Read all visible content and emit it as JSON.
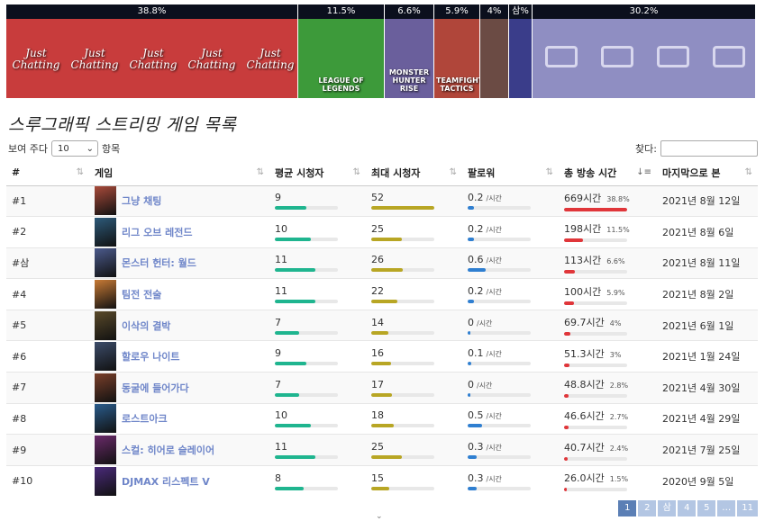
{
  "strip": [
    {
      "label": "38.8%",
      "caption": "Just Chatting",
      "color": "#c83c3c"
    },
    {
      "label": "11.5%",
      "caption": "LEAGUE OF LEGENDS",
      "color": "#3d9a3a"
    },
    {
      "label": "6.6%",
      "caption": "MONSTER HUNTER RISE",
      "color": "#6a5f9c"
    },
    {
      "label": "5.9%",
      "caption": "TEAMFIGHT TACTICS",
      "color": "#b0463a"
    },
    {
      "label": "4%",
      "caption": "",
      "color": "#6b4b44"
    },
    {
      "label": "삼%",
      "caption": "",
      "color": "#3a3d8a"
    },
    {
      "label": "30.2%",
      "caption": "",
      "color": "#8f8ec2"
    }
  ],
  "title": "스루그래픽 스트리밍 게임 목록",
  "length": {
    "prefix": "보여 주다",
    "value": "10",
    "suffix": "항목"
  },
  "search": {
    "label": "찾다:",
    "value": ""
  },
  "columns": [
    "#",
    "게임",
    "평균 시청자",
    "최대 시청자",
    "팔로워",
    "총 방송 시간",
    "마지막으로 본"
  ],
  "rows": [
    {
      "rank": "#1",
      "game": "그냥 채팅",
      "avg": "9",
      "avg_pct": 0.5,
      "max": "52",
      "max_pct": 1.0,
      "follow": "0.2",
      "follow_unit": "/시간",
      "follow_pct": 0.1,
      "hours": "669시간",
      "hours_pct_text": "38.8%",
      "hours_pct": 1.0,
      "last": "2021년 8월 12일",
      "thumb": "#a84a3a"
    },
    {
      "rank": "#2",
      "game": "리그 오브 레전드",
      "avg": "10",
      "avg_pct": 0.57,
      "max": "25",
      "max_pct": 0.48,
      "follow": "0.2",
      "follow_unit": "/시간",
      "follow_pct": 0.1,
      "hours": "198시간",
      "hours_pct_text": "11.5%",
      "hours_pct": 0.3,
      "last": "2021년 8월 6일",
      "thumb": "#2d5a7a"
    },
    {
      "rank": "#삼",
      "game": "몬스터 헌터: 월드",
      "avg": "11",
      "avg_pct": 0.64,
      "max": "26",
      "max_pct": 0.5,
      "follow": "0.6",
      "follow_unit": "/시간",
      "follow_pct": 0.28,
      "hours": "113시간",
      "hours_pct_text": "6.6%",
      "hours_pct": 0.17,
      "last": "2021년 8월 11일",
      "thumb": "#4b5a8c"
    },
    {
      "rank": "#4",
      "game": "팀전 전술",
      "avg": "11",
      "avg_pct": 0.64,
      "max": "22",
      "max_pct": 0.42,
      "follow": "0.2",
      "follow_unit": "/시간",
      "follow_pct": 0.1,
      "hours": "100시간",
      "hours_pct_text": "5.9%",
      "hours_pct": 0.15,
      "last": "2021년 8월 2일",
      "thumb": "#c77a35"
    },
    {
      "rank": "#5",
      "game": "이삭의 결박",
      "avg": "7",
      "avg_pct": 0.38,
      "max": "14",
      "max_pct": 0.27,
      "follow": "0",
      "follow_unit": "/시간",
      "follow_pct": 0,
      "hours": "69.7시간",
      "hours_pct_text": "4%",
      "hours_pct": 0.1,
      "last": "2021년 6월 1일",
      "thumb": "#5a4a2a"
    },
    {
      "rank": "#6",
      "game": "할로우 나이트",
      "avg": "9",
      "avg_pct": 0.5,
      "max": "16",
      "max_pct": 0.31,
      "follow": "0.1",
      "follow_unit": "/시간",
      "follow_pct": 0.05,
      "hours": "51.3시간",
      "hours_pct_text": "3%",
      "hours_pct": 0.08,
      "last": "2021년 1월 24일",
      "thumb": "#3c4c6a"
    },
    {
      "rank": "#7",
      "game": "동굴에 들어가다",
      "avg": "7",
      "avg_pct": 0.38,
      "max": "17",
      "max_pct": 0.33,
      "follow": "0",
      "follow_unit": "/시간",
      "follow_pct": 0,
      "hours": "48.8시간",
      "hours_pct_text": "2.8%",
      "hours_pct": 0.07,
      "last": "2021년 4월 30일",
      "thumb": "#7a3f2a"
    },
    {
      "rank": "#8",
      "game": "로스트아크",
      "avg": "10",
      "avg_pct": 0.57,
      "max": "18",
      "max_pct": 0.35,
      "follow": "0.5",
      "follow_unit": "/시간",
      "follow_pct": 0.23,
      "hours": "46.6시간",
      "hours_pct_text": "2.7%",
      "hours_pct": 0.07,
      "last": "2021년 4월 29일",
      "thumb": "#2a5c8c"
    },
    {
      "rank": "#9",
      "game": "스컬: 히어로 슬레이어",
      "avg": "11",
      "avg_pct": 0.64,
      "max": "25",
      "max_pct": 0.48,
      "follow": "0.3",
      "follow_unit": "/시간",
      "follow_pct": 0.14,
      "hours": "40.7시간",
      "hours_pct_text": "2.4%",
      "hours_pct": 0.06,
      "last": "2021년 7월 25일",
      "thumb": "#6a2a6a"
    },
    {
      "rank": "#10",
      "game": "DJMAX 리스펙트 V",
      "avg": "8",
      "avg_pct": 0.45,
      "max": "15",
      "max_pct": 0.29,
      "follow": "0.3",
      "follow_unit": "/시간",
      "follow_pct": 0.14,
      "hours": "26.0시간",
      "hours_pct_text": "1.5%",
      "hours_pct": 0.04,
      "last": "2020년 9월 5일",
      "thumb": "#4a2a7a"
    }
  ],
  "colors": {
    "avg": "#1fb58f",
    "max": "#b8a624",
    "follow": "#2f7fd1",
    "hours": "#e0363a"
  },
  "pagination": [
    "1",
    "2",
    "삼",
    "4",
    "5",
    "…",
    "11"
  ],
  "pagination_active": "1"
}
